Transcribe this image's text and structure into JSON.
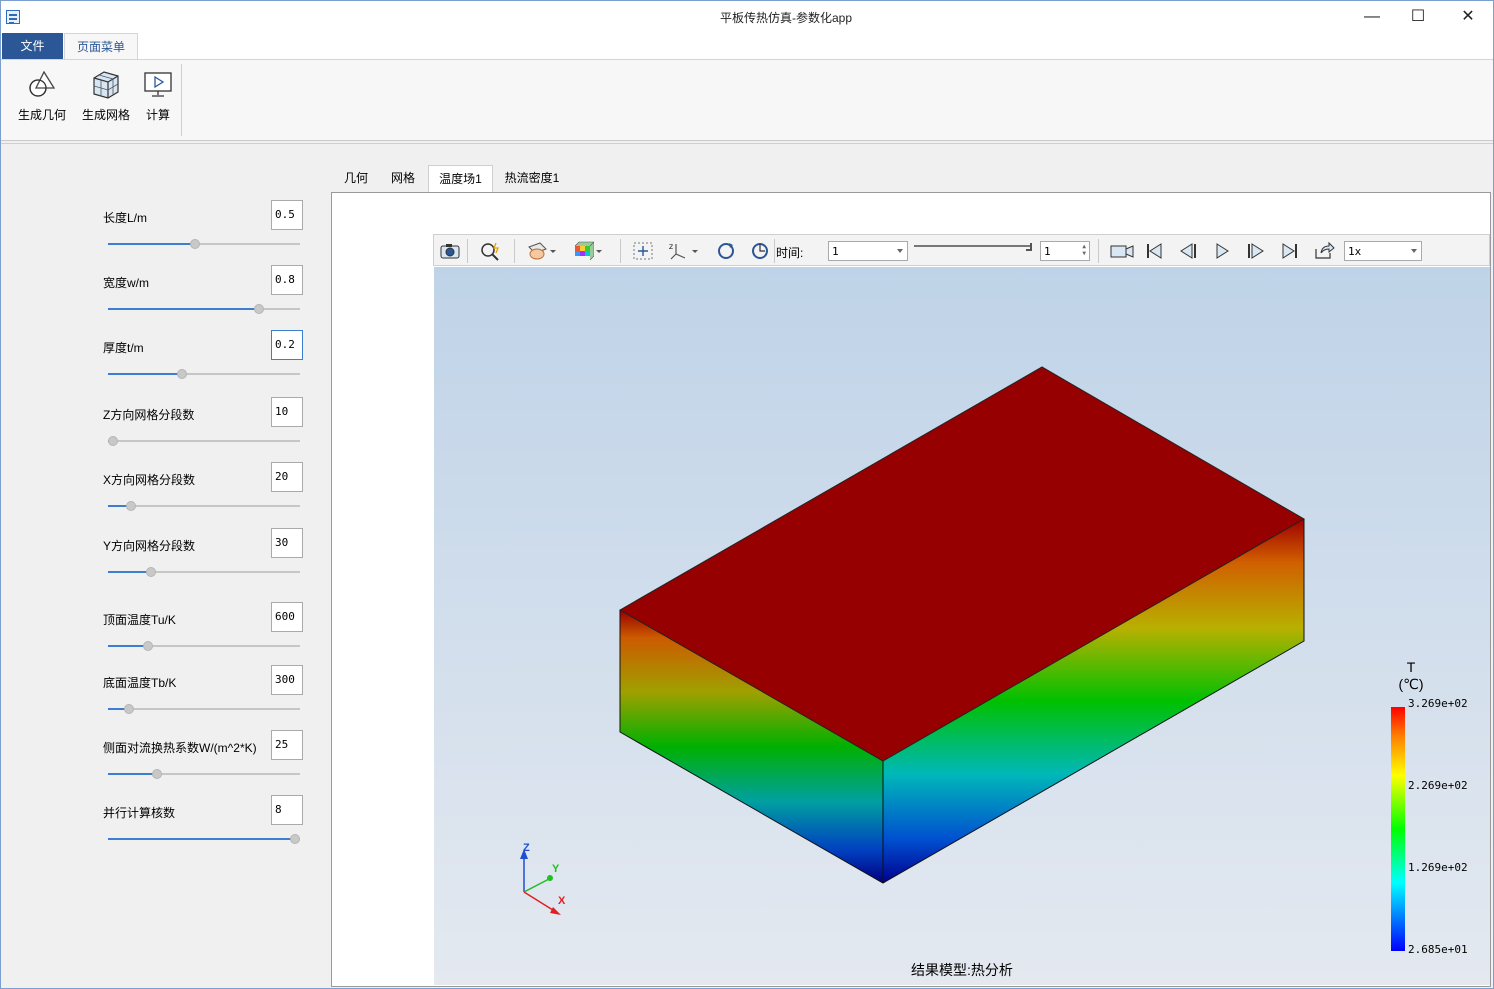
{
  "window": {
    "title": "平板传热仿真-参数化app",
    "minimize": "—",
    "maximize": "☐",
    "close": "✕"
  },
  "ribbon": {
    "file_tab": "文件",
    "page_tab": "页面菜单",
    "buttons": [
      {
        "label": "生成几何",
        "icon": "geometry-icon"
      },
      {
        "label": "生成网格",
        "icon": "mesh-icon"
      },
      {
        "label": "计算",
        "icon": "compute-icon"
      }
    ]
  },
  "params": [
    {
      "label": "长度L/m",
      "value": "0.5",
      "level": 0.45
    },
    {
      "label": "宽度w/m",
      "value": "0.8",
      "level": 0.8
    },
    {
      "label": "厚度t/m",
      "value": "0.2",
      "level": 0.38,
      "focused": true
    },
    {
      "label": "Z方向网格分段数",
      "value": "10",
      "level": 0.0
    },
    {
      "label": "X方向网格分段数",
      "value": "20",
      "level": 0.1
    },
    {
      "label": "Y方向网格分段数",
      "value": "30",
      "level": 0.21
    },
    {
      "label": "顶面温度Tu/K",
      "value": "600",
      "level": 0.19
    },
    {
      "label": "底面温度Tb/K",
      "value": "300",
      "level": 0.09
    },
    {
      "label": "侧面对流换热系数W/(m^2*K)",
      "value": "25",
      "level": 0.24
    },
    {
      "label": "并行计算核数",
      "value": "8",
      "level": 1.0
    }
  ],
  "view_tabs": [
    "几何",
    "网格",
    "温度场1",
    "热流密度1"
  ],
  "active_view_tab": "温度场1",
  "toolbar": {
    "time_label": "时间:",
    "time_value": "1",
    "step_value": "1",
    "speed_value": "1x"
  },
  "viewport": {
    "model_label": "结果模型:热分析",
    "axes": {
      "x": "X",
      "y": "Y",
      "z": "Z"
    },
    "legend": {
      "variable": "T",
      "unit": "(℃)",
      "values": [
        "3.269e+02",
        "2.269e+02",
        "1.269e+02",
        "2.685e+01"
      ]
    }
  },
  "colors": {
    "accent": "#2b5797",
    "slider_fill": "#3c7fd1",
    "top_face": "#960000"
  }
}
